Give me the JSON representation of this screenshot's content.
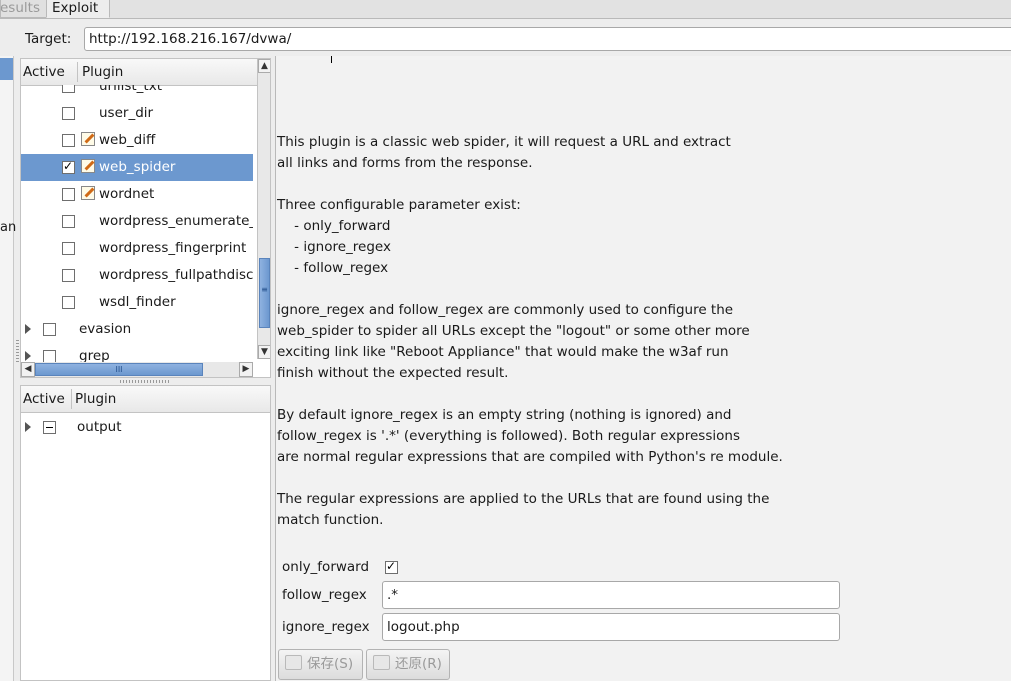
{
  "tabs": {
    "results": "esults",
    "exploit": "Exploit"
  },
  "target": {
    "label": "Target:",
    "url": "http://192.168.216.167/dvwa/"
  },
  "left_fragment": "an",
  "plugins_list": {
    "col_active": "Active",
    "col_plugin": "Plugin",
    "rows": [
      {
        "label": "urllist_txt",
        "checked": false,
        "editable": false
      },
      {
        "label": "user_dir",
        "checked": false,
        "editable": false
      },
      {
        "label": "web_diff",
        "checked": false,
        "editable": true
      },
      {
        "label": "web_spider",
        "checked": true,
        "editable": true,
        "selected": true
      },
      {
        "label": "wordnet",
        "checked": false,
        "editable": true
      },
      {
        "label": "wordpress_enumerate_",
        "checked": false,
        "editable": false
      },
      {
        "label": "wordpress_fingerprint",
        "checked": false,
        "editable": false
      },
      {
        "label": "wordpress_fullpathdisc",
        "checked": false,
        "editable": false
      },
      {
        "label": "wsdl_finder",
        "checked": false,
        "editable": false
      },
      {
        "label": "evasion",
        "group": true
      },
      {
        "label": "grep",
        "group": true
      }
    ],
    "scroll_grip": "≡",
    "hscroll_grip": "III"
  },
  "output_list": {
    "col_active": "Active",
    "col_plugin": "Plugin",
    "rows": [
      {
        "label": "output",
        "group": true,
        "partial": true
      }
    ]
  },
  "description": "This plugin is a classic web spider, it will request a URL and extract\nall links and forms from the response.\n\nThree configurable parameter exist:\n    - only_forward\n    - ignore_regex\n    - follow_regex\n\nignore_regex and follow_regex are commonly used to configure the\nweb_spider to spider all URLs except the \"logout\" or some other more\nexciting link like \"Reboot Appliance\" that would make the w3af run\nfinish without the expected result.\n\nBy default ignore_regex is an empty string (nothing is ignored) and\nfollow_regex is '.*' (everything is followed). Both regular expressions\nare normal regular expressions that are compiled with Python's re module.\n\nThe regular expressions are applied to the URLs that are found using the\nmatch function.",
  "options": {
    "only_forward": {
      "label": "only_forward",
      "checked": true
    },
    "follow_regex": {
      "label": "follow_regex",
      "value": ".*"
    },
    "ignore_regex": {
      "label": "ignore_regex",
      "value": "logout.php"
    }
  },
  "buttons": {
    "save": "保存(S)",
    "revert": "还原(R)"
  }
}
